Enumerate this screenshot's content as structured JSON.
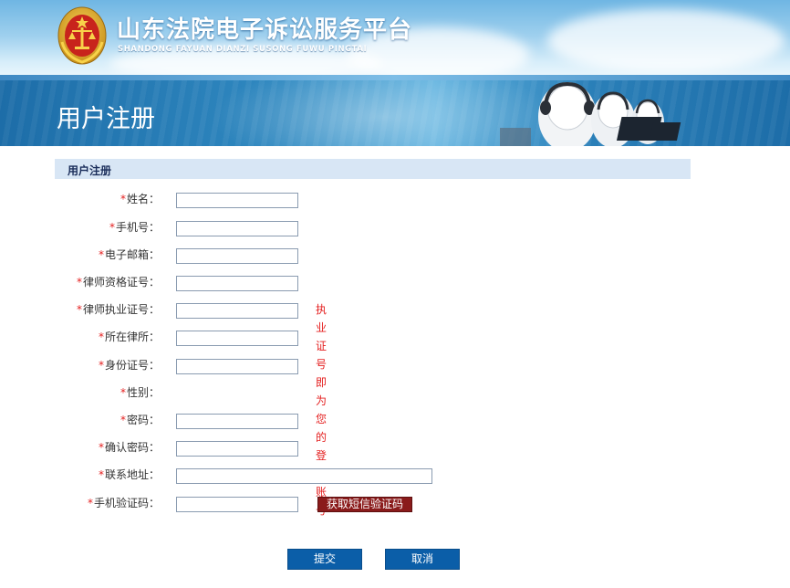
{
  "header": {
    "site_title": "山东法院电子诉讼服务平台",
    "site_subtitle": "SHANDONG FAYUAN DIANZI SUSONG FUWU PINGTAI",
    "emblem_icon": "court-emblem-icon"
  },
  "banner": {
    "title": "用户注册",
    "illustration_icon": "call-center-operators-icon"
  },
  "section": {
    "title": "用户注册"
  },
  "form": {
    "required_mark": "*",
    "fields": [
      {
        "label": "姓名：",
        "value": ""
      },
      {
        "label": "手机号：",
        "value": ""
      },
      {
        "label": "电子邮箱：",
        "value": ""
      },
      {
        "label": "律师资格证号：",
        "value": ""
      },
      {
        "label": "律师执业证号：",
        "value": ""
      },
      {
        "label": "所在律所：",
        "value": ""
      },
      {
        "label": "身份证号：",
        "value": ""
      },
      {
        "label": "性别：",
        "value": ""
      },
      {
        "label": "密码：",
        "value": ""
      },
      {
        "label": "确认密码：",
        "value": ""
      },
      {
        "label": "联系地址：",
        "value": ""
      },
      {
        "label": "手机验证码：",
        "value": ""
      }
    ],
    "license_hint": "执业证号即为您的登录账号",
    "sms_button": "获取短信验证码"
  },
  "actions": {
    "submit_label": "提交",
    "cancel_label": "取消"
  },
  "colors": {
    "required": "#e41e1e",
    "primary_button": "#0b5ea8",
    "sms_button": "#8a1b1b",
    "section_head_bg": "#d8e6f5",
    "banner_bg": "#2f88c0"
  }
}
